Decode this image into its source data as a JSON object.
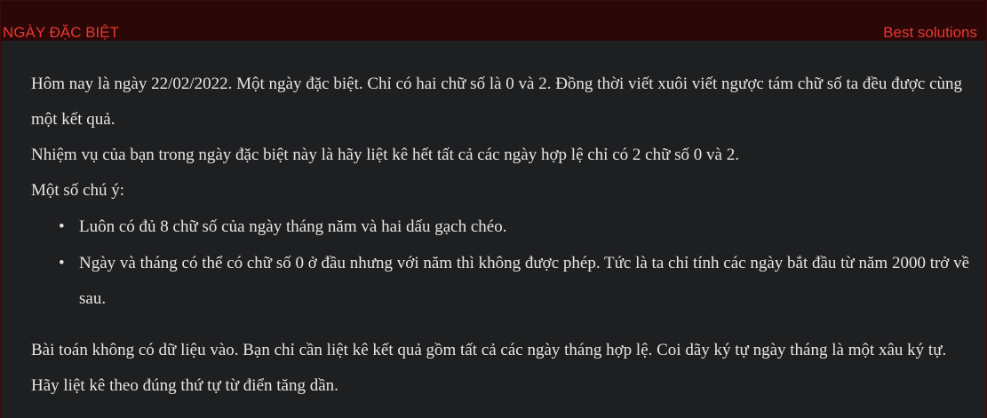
{
  "header": {
    "left_label": "NGÀY ĐẶC BIỆT",
    "right_label": "Best solutions"
  },
  "body": {
    "paragraph1": "Hôm nay là ngày 22/02/2022. Một ngày đặc biệt. Chỉ có hai chữ số là 0 và 2. Đồng thời viết xuôi viết ngược tám chữ số ta đều được cùng một kết quả.",
    "paragraph2": "Nhiệm vụ của bạn trong ngày đặc biệt này là hãy liệt kê hết tất cả các ngày hợp lệ chỉ có 2 chữ số 0 và 2.",
    "paragraph3": "Một số chú ý:",
    "notes": [
      "Luôn có đủ 8 chữ số của ngày tháng năm và hai dấu gạch chéo.",
      "Ngày và tháng có thể có chữ số 0 ở đầu nhưng với năm thì không được phép. Tức là ta chỉ tính các ngày bắt đầu từ năm 2000 trở về sau."
    ],
    "paragraph4": "Bài toán không có dữ liệu vào. Bạn chỉ cần liệt kê kết quả gồm tất cả các ngày tháng hợp lệ. Coi dãy ký tự ngày tháng là một xâu ký tự. Hãy liệt kê theo đúng thứ tự từ điển tăng dần."
  },
  "colors": {
    "header_bg": "#2a0808",
    "header_text": "#e8372f",
    "page_bg": "#1e1f21",
    "body_text": "#e6e6e6"
  }
}
